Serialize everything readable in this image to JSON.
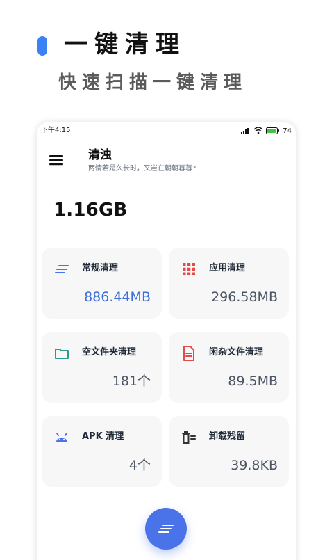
{
  "promo": {
    "title": "一键清理",
    "subtitle": "快速扫描一键清理",
    "accent_color": "#3b82f6"
  },
  "status_bar": {
    "time": "下午4:15",
    "battery": "74"
  },
  "app_bar": {
    "title": "清浊",
    "subtitle": "两情若是久长时，又岂在朝朝暮暮?"
  },
  "summary": {
    "total_size": "1.16GB"
  },
  "cards": [
    {
      "label": "常规清理",
      "value": "886.44MB",
      "icon": "lines-icon",
      "icon_color": "#4a73ea"
    },
    {
      "label": "应用清理",
      "value": "296.58MB",
      "icon": "grid-icon",
      "icon_color": "#e34b4b"
    },
    {
      "label": "空文件夹清理",
      "value": "181个",
      "icon": "folder-icon",
      "icon_color": "#2f9a8a"
    },
    {
      "label": "闲杂文件清理",
      "value": "89.5MB",
      "icon": "document-icon",
      "icon_color": "#e34b4b"
    },
    {
      "label": "APK 清理",
      "value": "4个",
      "icon": "android-icon",
      "icon_color": "#4a73ea"
    },
    {
      "label": "卸载残留",
      "value": "39.8KB",
      "icon": "trash-list-icon",
      "icon_color": "#333333"
    }
  ],
  "colors": {
    "accent_blue": "#4a73ea",
    "card_bg": "#f7f7f7"
  },
  "fab": {
    "icon": "lines-icon"
  }
}
